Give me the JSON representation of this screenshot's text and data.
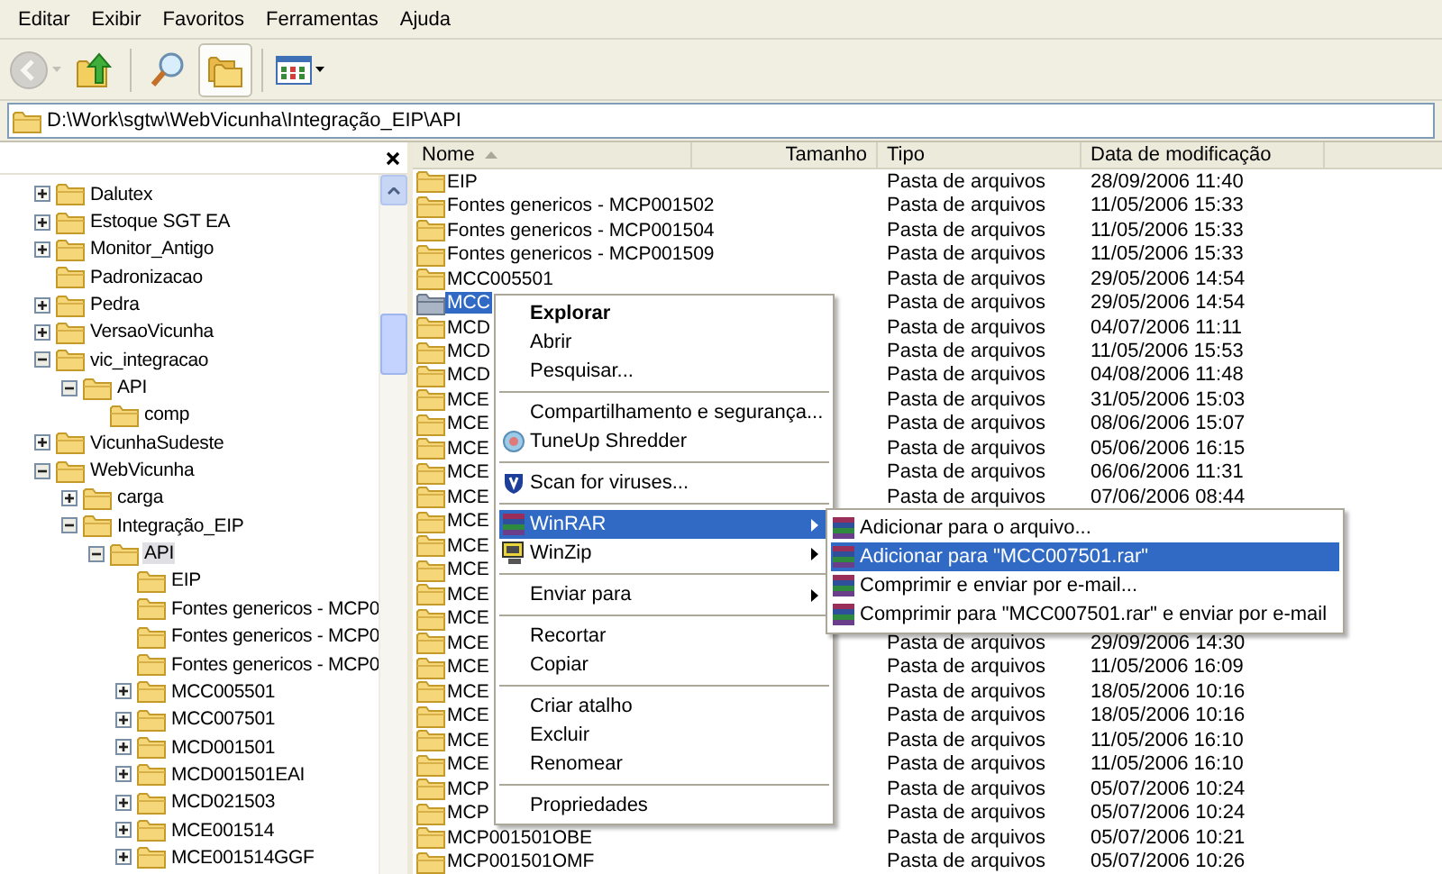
{
  "menu_bar": [
    "Editar",
    "Exibir",
    "Favoritos",
    "Ferramentas",
    "Ajuda"
  ],
  "toolbar": [
    {
      "kind": "back",
      "disabled": true
    },
    {
      "kind": "up",
      "disabled": false
    },
    {
      "kind": "search",
      "disabled": false
    },
    {
      "kind": "folders",
      "disabled": false,
      "pressed": true
    },
    {
      "kind": "views",
      "disabled": false
    }
  ],
  "address": {
    "path": "D:\\Work\\sgtw\\WebVicunha\\Integração_EIP\\API"
  },
  "folders_pane": {
    "tree": [
      {
        "label": "Dalutex",
        "kind": "branch",
        "expanded": false,
        "selected": false
      },
      {
        "label": "Estoque SGT EA",
        "kind": "branch",
        "expanded": false,
        "selected": false
      },
      {
        "label": "Monitor_Antigo",
        "kind": "branch",
        "expanded": false,
        "selected": false
      },
      {
        "label": "Padronizacao",
        "kind": "leaf",
        "selected": false
      },
      {
        "label": "Pedra",
        "kind": "branch",
        "expanded": false,
        "selected": false
      },
      {
        "label": "VersaoVicunha",
        "kind": "branch",
        "expanded": false,
        "selected": false
      },
      {
        "label": "vic_integracao",
        "kind": "branch",
        "expanded": true,
        "selected": false,
        "children": [
          {
            "label": "API",
            "kind": "branch",
            "expanded": true,
            "selected": false,
            "children": [
              {
                "label": "comp",
                "kind": "leaf",
                "selected": false
              }
            ]
          }
        ]
      },
      {
        "label": "VicunhaSudeste",
        "kind": "branch",
        "expanded": false,
        "selected": false
      },
      {
        "label": "WebVicunha",
        "kind": "branch",
        "expanded": true,
        "selected": false,
        "children": [
          {
            "label": "carga",
            "kind": "branch",
            "expanded": false,
            "selected": false
          },
          {
            "label": "Integração_EIP",
            "kind": "branch",
            "expanded": true,
            "selected": false,
            "children": [
              {
                "label": "API",
                "kind": "branch",
                "expanded": true,
                "selected": true,
                "children": [
                  {
                    "label": "EIP",
                    "kind": "leaf",
                    "selected": false
                  },
                  {
                    "label": "Fontes genericos - MCP0",
                    "kind": "leaf",
                    "selected": false
                  },
                  {
                    "label": "Fontes genericos - MCP0",
                    "kind": "leaf",
                    "selected": false
                  },
                  {
                    "label": "Fontes genericos - MCP0",
                    "kind": "leaf",
                    "selected": false
                  },
                  {
                    "label": "MCC005501",
                    "kind": "branch",
                    "expanded": false,
                    "selected": false
                  },
                  {
                    "label": "MCC007501",
                    "kind": "branch",
                    "expanded": false,
                    "selected": false
                  },
                  {
                    "label": "MCD001501",
                    "kind": "branch",
                    "expanded": false,
                    "selected": false
                  },
                  {
                    "label": "MCD001501EAI",
                    "kind": "branch",
                    "expanded": false,
                    "selected": false
                  },
                  {
                    "label": "MCD021503",
                    "kind": "branch",
                    "expanded": false,
                    "selected": false
                  },
                  {
                    "label": "MCE001514",
                    "kind": "branch",
                    "expanded": false,
                    "selected": false
                  },
                  {
                    "label": "MCE001514GGF",
                    "kind": "branch",
                    "expanded": false,
                    "selected": false
                  }
                ]
              }
            ]
          }
        ]
      }
    ]
  },
  "file_list": {
    "columns": [
      {
        "kind": "name",
        "label": "Nome",
        "sorted": true
      },
      {
        "kind": "size",
        "label": "Tamanho",
        "sorted": false
      },
      {
        "kind": "type",
        "label": "Tipo",
        "sorted": false
      },
      {
        "kind": "modified",
        "label": "Data de modificação",
        "sorted": false
      }
    ],
    "rows": [
      {
        "name": "EIP",
        "type": "Pasta de arquivos",
        "modified": "28/09/2006 11:40",
        "selected": false
      },
      {
        "name": "Fontes genericos - MCP001502",
        "type": "Pasta de arquivos",
        "modified": "11/05/2006 15:33",
        "selected": false
      },
      {
        "name": "Fontes genericos - MCP001504",
        "type": "Pasta de arquivos",
        "modified": "11/05/2006 15:33",
        "selected": false
      },
      {
        "name": "Fontes genericos - MCP001509",
        "type": "Pasta de arquivos",
        "modified": "11/05/2006 15:33",
        "selected": false
      },
      {
        "name": "MCC005501",
        "type": "Pasta de arquivos",
        "modified": "29/05/2006 14:54",
        "selected": false
      },
      {
        "name": "MCC",
        "type": "Pasta de arquivos",
        "modified": "29/05/2006 14:54",
        "selected": true
      },
      {
        "name": "MCD",
        "type": "Pasta de arquivos",
        "modified": "04/07/2006 11:11",
        "selected": false
      },
      {
        "name": "MCD",
        "type": "Pasta de arquivos",
        "modified": "11/05/2006 15:53",
        "selected": false
      },
      {
        "name": "MCD",
        "type": "Pasta de arquivos",
        "modified": "04/08/2006 11:48",
        "selected": false
      },
      {
        "name": "MCE",
        "type": "Pasta de arquivos",
        "modified": "31/05/2006 15:03",
        "selected": false
      },
      {
        "name": "MCE",
        "type": "Pasta de arquivos",
        "modified": "08/06/2006 15:07",
        "selected": false
      },
      {
        "name": "MCE",
        "type": "Pasta de arquivos",
        "modified": "05/06/2006 16:15",
        "selected": false
      },
      {
        "name": "MCE",
        "type": "Pasta de arquivos",
        "modified": "06/06/2006 11:31",
        "selected": false
      },
      {
        "name": "MCE",
        "type": "Pasta de arquivos",
        "modified": "07/06/2006 08:44",
        "selected": false
      },
      {
        "name": "MCE",
        "selected": false
      },
      {
        "name": "MCE",
        "selected": false
      },
      {
        "name": "MCE",
        "selected": false
      },
      {
        "name": "MCE",
        "selected": false
      },
      {
        "name": "MCE",
        "selected": false
      },
      {
        "name": "MCE",
        "type": "Pasta de arquivos",
        "modified": "29/09/2006 14:30",
        "selected": false
      },
      {
        "name": "MCE",
        "type": "Pasta de arquivos",
        "modified": "11/05/2006 16:09",
        "selected": false
      },
      {
        "name": "MCE",
        "type": "Pasta de arquivos",
        "modified": "18/05/2006 10:16",
        "selected": false
      },
      {
        "name": "MCE",
        "type": "Pasta de arquivos",
        "modified": "18/05/2006 10:16",
        "selected": false
      },
      {
        "name": "MCE",
        "type": "Pasta de arquivos",
        "modified": "11/05/2006 16:10",
        "selected": false
      },
      {
        "name": "MCE",
        "type": "Pasta de arquivos",
        "modified": "11/05/2006 16:10",
        "selected": false
      },
      {
        "name": "MCP",
        "type": "Pasta de arquivos",
        "modified": "05/07/2006 10:24",
        "selected": false
      },
      {
        "name": "MCP",
        "type": "Pasta de arquivos",
        "modified": "05/07/2006 10:24",
        "selected": false
      },
      {
        "name": "MCP001501OBE",
        "type": "Pasta de arquivos",
        "modified": "05/07/2006 10:21",
        "selected": false
      },
      {
        "name": "MCP001501OMF",
        "type": "Pasta de arquivos",
        "modified": "05/07/2006 10:26",
        "selected": false
      }
    ]
  },
  "context_menu": {
    "items": [
      {
        "kind": "plain",
        "label": "Explorar",
        "bold": true,
        "submenu": false,
        "selected": false
      },
      {
        "kind": "plain",
        "label": "Abrir",
        "bold": false,
        "submenu": false,
        "selected": false
      },
      {
        "kind": "plain",
        "label": "Pesquisar...",
        "bold": false,
        "submenu": false,
        "selected": false
      },
      {
        "kind": "separator"
      },
      {
        "kind": "plain",
        "label": "Compartilhamento e segurança...",
        "bold": false,
        "submenu": false,
        "selected": false
      },
      {
        "kind": "shredder",
        "label": "TuneUp Shredder",
        "bold": false,
        "submenu": false,
        "selected": false
      },
      {
        "kind": "separator"
      },
      {
        "kind": "antivirus",
        "label": "Scan for viruses...",
        "bold": false,
        "submenu": false,
        "selected": false
      },
      {
        "kind": "separator"
      },
      {
        "kind": "archiver",
        "label": "WinRAR",
        "bold": false,
        "submenu": true,
        "selected": true
      },
      {
        "kind": "zipper",
        "label": "WinZip",
        "bold": false,
        "submenu": true,
        "selected": false
      },
      {
        "kind": "separator"
      },
      {
        "kind": "plain",
        "label": "Enviar para",
        "bold": false,
        "submenu": true,
        "selected": false
      },
      {
        "kind": "separator"
      },
      {
        "kind": "plain",
        "label": "Recortar",
        "bold": false,
        "submenu": false,
        "selected": false
      },
      {
        "kind": "plain",
        "label": "Copiar",
        "bold": false,
        "submenu": false,
        "selected": false
      },
      {
        "kind": "separator"
      },
      {
        "kind": "plain",
        "label": "Criar atalho",
        "bold": false,
        "submenu": false,
        "selected": false
      },
      {
        "kind": "plain",
        "label": "Excluir",
        "bold": false,
        "submenu": false,
        "selected": false
      },
      {
        "kind": "plain",
        "label": "Renomear",
        "bold": false,
        "submenu": false,
        "selected": false
      },
      {
        "kind": "separator"
      },
      {
        "kind": "plain",
        "label": "Propriedades",
        "bold": false,
        "submenu": false,
        "selected": false
      }
    ]
  },
  "submenu": {
    "items": [
      {
        "label": "Adicionar para o arquivo...",
        "selected": false
      },
      {
        "label": "Adicionar para \"MCC007501.rar\"",
        "selected": true
      },
      {
        "label": "Comprimir e enviar por e-mail...",
        "selected": false
      },
      {
        "label": "Comprimir para \"MCC007501.rar\" e enviar por e-mail",
        "selected": false
      }
    ]
  }
}
